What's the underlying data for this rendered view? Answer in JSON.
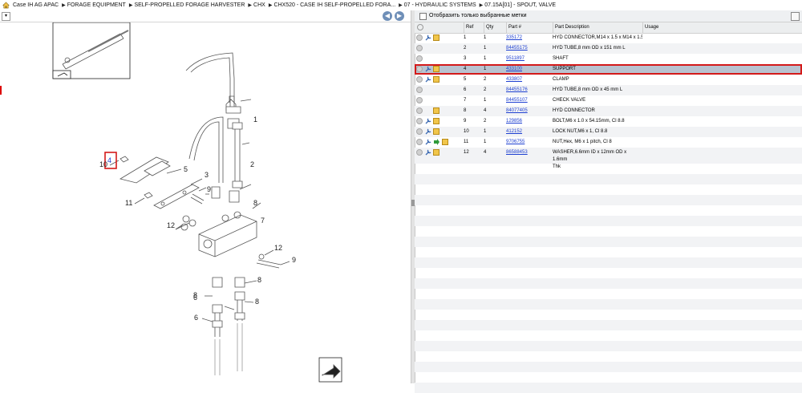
{
  "breadcrumb": [
    "Case IH AG APAC",
    "FORAGE EQUIPMENT",
    "SELF-PROPELLED FORAGE HARVESTER",
    "CHX",
    "CHX520 - CASE IH SELF-PROPELLED FORA...",
    "07 - HYDRAULIC SYSTEMS",
    "07.15A[01] - SPOUT, VALVE"
  ],
  "filter": {
    "label": "Отобразить только выбранные метки"
  },
  "table": {
    "columns": {
      "ref": "Ref",
      "qty": "Qty",
      "part": "Part #",
      "desc": "Part Description",
      "usage": "Usage"
    },
    "rows": [
      {
        "ref": "1",
        "qty": "1",
        "part": "335172",
        "desc": "HYD CONNECTOR,M14 x 1.5 x M14 x 1.5",
        "desc2": "",
        "icons": "wrench,box"
      },
      {
        "ref": "2",
        "qty": "1",
        "part": "84455175",
        "desc": "HYD TUBE,8 mm OD x 151 mm L",
        "desc2": "",
        "icons": ""
      },
      {
        "ref": "3",
        "qty": "1",
        "part": "9511897",
        "desc": "SHAFT",
        "desc2": "",
        "icons": ""
      },
      {
        "ref": "4",
        "qty": "1",
        "part": "433100",
        "desc": "SUPPORT",
        "desc2": "",
        "icons": "wrench,box"
      },
      {
        "ref": "5",
        "qty": "2",
        "part": "433807",
        "desc": "CLAMP",
        "desc2": "",
        "icons": "wrench,box"
      },
      {
        "ref": "6",
        "qty": "2",
        "part": "84455176",
        "desc": "HYD TUBE,8 mm OD x 45 mm L",
        "desc2": "",
        "icons": ""
      },
      {
        "ref": "7",
        "qty": "1",
        "part": "84455107",
        "desc": "CHECK VALVE",
        "desc2": "",
        "icons": ""
      },
      {
        "ref": "8",
        "qty": "4",
        "part": "84077405",
        "desc": "HYD CONNECTOR",
        "desc2": "",
        "icons": "box"
      },
      {
        "ref": "9",
        "qty": "2",
        "part": "129856",
        "desc": "BOLT,M6 x 1.0 x 54.15mm, Cl 8.8",
        "desc2": "",
        "icons": "wrench,box"
      },
      {
        "ref": "10",
        "qty": "1",
        "part": "412152",
        "desc": "LOCK NUT,M6 x 1, Cl 8.8",
        "desc2": "",
        "icons": "wrench,box"
      },
      {
        "ref": "11",
        "qty": "1",
        "part": "9706755",
        "desc": "NUT,Hex, M6 x 1 pitch, Cl 8",
        "desc2": "",
        "icons": "wrench,arrow,box"
      },
      {
        "ref": "12",
        "qty": "4",
        "part": "86588453",
        "desc": "WASHER,6.6mm ID x 12mm OD x 1.6mm",
        "desc2": "Thk",
        "icons": "wrench,box"
      }
    ],
    "selected_ref": "4"
  },
  "diagram": {
    "callouts": [
      "1",
      "2",
      "3",
      "4",
      "5",
      "6",
      "6",
      "7",
      "8",
      "8",
      "8",
      "8",
      "9",
      "9",
      "10",
      "11",
      "12",
      "12"
    ]
  },
  "colors": {
    "selection": "#b9c3d0",
    "selection_border": "#d41a1a",
    "link": "#1d3fd1",
    "nav_button": "#6f8fb8"
  }
}
